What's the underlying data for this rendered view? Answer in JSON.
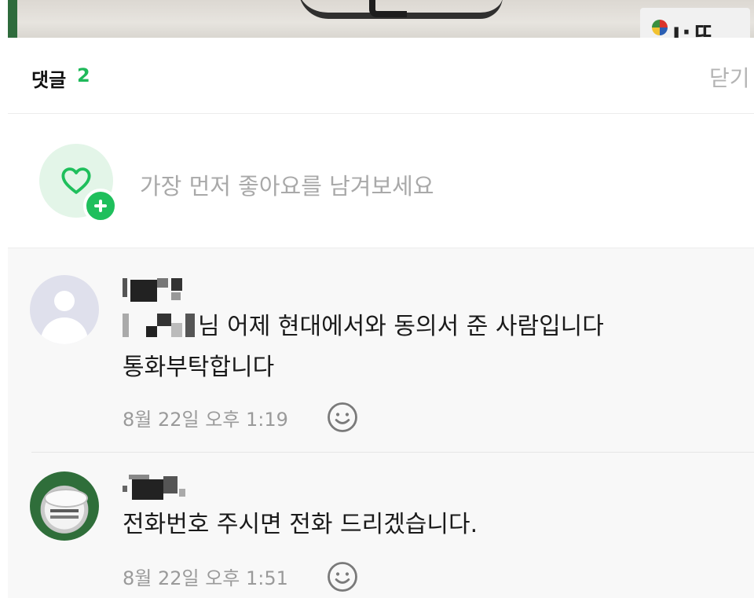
{
  "header": {
    "title": "댓글",
    "count": "2",
    "close_label": "닫기"
  },
  "banner": {
    "logo_text": "ı·ㄸ"
  },
  "like_prompt": {
    "text": "가장 먼저 좋아요를 남겨보세요"
  },
  "comments": [
    {
      "text_line1": "님 어제 현대에서와 동의서 준 사람입니다",
      "text_line2": "통화부탁합니다",
      "timestamp": "8월 22일 오후 1:19",
      "avatar": "default-user-icon"
    },
    {
      "text_line1": "전화번호 주시면 전화 드리겠습니다.",
      "timestamp": "8월 22일 오후 1:51",
      "avatar": "user-photo"
    }
  ],
  "colors": {
    "accent_green": "#1fb95a",
    "muted_text": "#9a9a9a",
    "background": "#f8f8f8"
  }
}
